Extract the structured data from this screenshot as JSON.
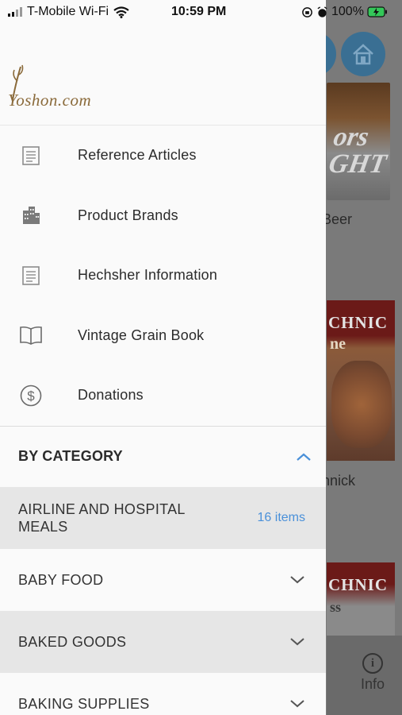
{
  "status_bar": {
    "carrier": "T-Mobile Wi-Fi",
    "time": "10:59 PM",
    "battery": "100%"
  },
  "logo": {
    "text": "Yoshon.com"
  },
  "menu": {
    "items": [
      {
        "label": "Reference Articles",
        "icon": "article-icon"
      },
      {
        "label": "Product Brands",
        "icon": "building-icon"
      },
      {
        "label": "Hechsher Information",
        "icon": "article-icon"
      },
      {
        "label": "Vintage Grain Book",
        "icon": "book-icon"
      },
      {
        "label": "Donations",
        "icon": "dollar-icon"
      }
    ]
  },
  "category": {
    "title": "BY CATEGORY",
    "rows": [
      {
        "name": "AIRLINE AND HOSPITAL MEALS",
        "count": "16 items"
      },
      {
        "name": "BABY FOOD"
      },
      {
        "name": "BAKED GOODS"
      },
      {
        "name": "BAKING SUPPLIES"
      }
    ]
  },
  "background": {
    "item1_caption": "Beer",
    "item2_caption": "nnick",
    "tab_info_label": "Info",
    "product_brand_text": "CHNIC",
    "product_sub_text": "ne",
    "product_sub_text2": "ss",
    "can_text": "ors\nGHT"
  },
  "colors": {
    "accent": "#4a90d9",
    "home_button": "#3a6f93",
    "logo": "#8a6a3a"
  }
}
